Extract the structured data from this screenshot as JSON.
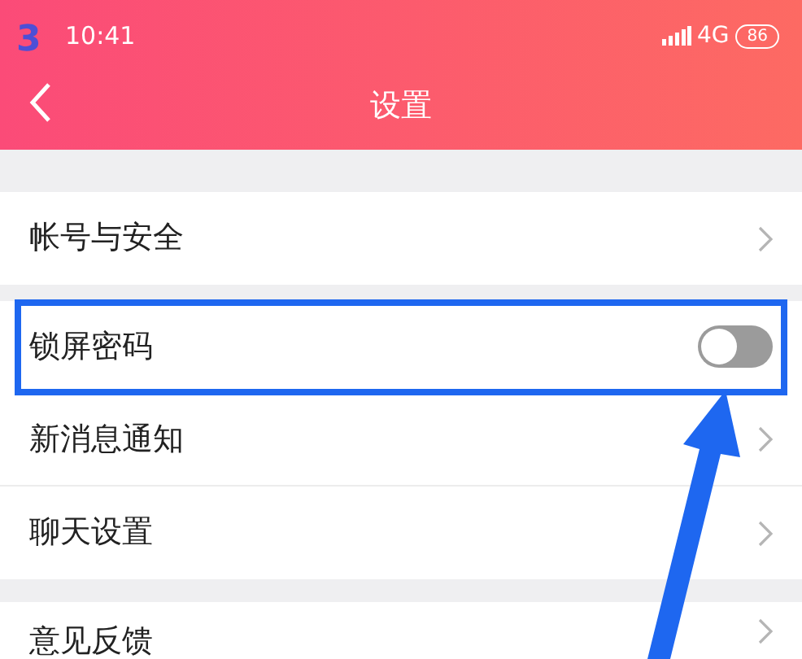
{
  "step_number": "3",
  "status_bar": {
    "time": "10:41",
    "network": "4G",
    "battery": "86"
  },
  "header": {
    "title": "设置"
  },
  "sections": [
    {
      "items": [
        {
          "label": "帐号与安全",
          "kind": "link",
          "highlighted": false
        }
      ]
    },
    {
      "items": [
        {
          "label": "锁屏密码",
          "kind": "switch",
          "on": false,
          "highlighted": true
        },
        {
          "label": "新消息通知",
          "kind": "link",
          "highlighted": false
        },
        {
          "label": "聊天设置",
          "kind": "link",
          "highlighted": false
        }
      ]
    },
    {
      "items": [
        {
          "label": "意见反馈",
          "kind": "link",
          "highlighted": false
        }
      ]
    }
  ]
}
